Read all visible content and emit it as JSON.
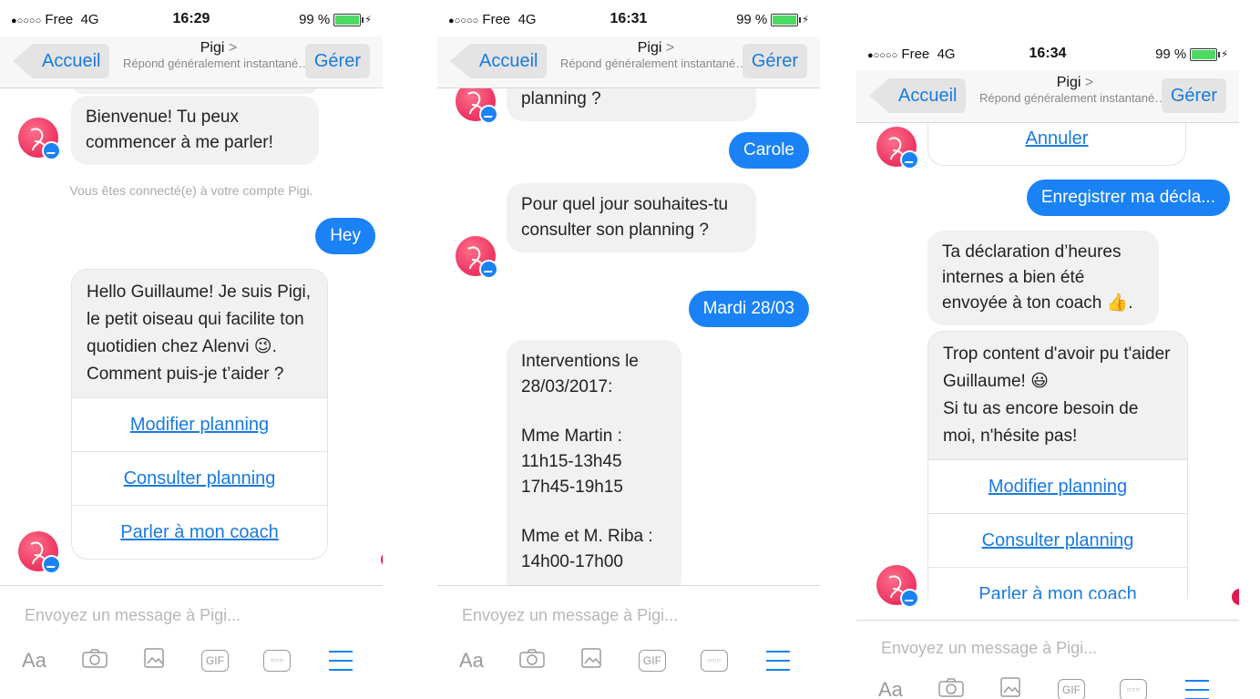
{
  "status": {
    "carrier_dots": "●○○○○",
    "carrier": "Free",
    "network": "4G",
    "battery": "99 %",
    "times": [
      "16:29",
      "16:31",
      "16:34"
    ]
  },
  "nav": {
    "back": "Accueil",
    "title": "Pigi",
    "chevron": ">",
    "subtitle": "Répond généralement instantanément",
    "manage": "Gérer"
  },
  "composer": {
    "placeholder": "Envoyez un message à Pigi...",
    "aa": "Aa",
    "gif": "GIF",
    "more": "○○○"
  },
  "screen1": {
    "welcome": "Bienvenue! Tu peux commencer à me parler!",
    "system": "Vous êtes connecté(e) à votre compte Pigi.",
    "sent": "Hey",
    "intro": "Hello Guillaume! Je suis Pigi, le petit oiseau qui facilite ton quotidien chez Alenvi 😉. Comment puis-je t’aider ?",
    "options": [
      "Modifier planning",
      "Consulter planning",
      "Parler à mon coach"
    ]
  },
  "screen2": {
    "partial": "planning ?",
    "sent1": "Carole",
    "question": "Pour quel jour souhaites-tu consulter son planning ?",
    "sent2": "Mardi 28/03",
    "interventions": {
      "title": "Interventions le 28/03/2017:",
      "client1": "Mme Martin :",
      "client1_slot1": "11h15-13h45",
      "client1_slot2": "17h45-19h15",
      "client2": "Mme et M. Riba :",
      "client2_slot1": "14h00-17h00"
    }
  },
  "screen3": {
    "cancel": "Annuler",
    "sent": "Enregistrer ma décla...",
    "confirm": "Ta déclaration d’heures internes a bien été envoyée à ton coach 👍.",
    "thanks_line1": "Trop content d'avoir pu t'aider Guillaume! 😃",
    "thanks_line2": "Si tu as encore besoin de moi, n'hésite pas!",
    "options": [
      "Modifier planning",
      "Consulter planning",
      "Parler à mon coach"
    ]
  },
  "colors": {
    "accent": "#1a82f5",
    "link": "#1a7ae0",
    "bot_bubble": "#f1f1f1",
    "avatar": "#e3174d"
  }
}
